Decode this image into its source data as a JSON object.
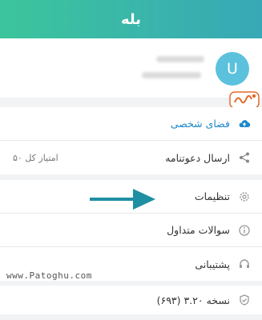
{
  "header": {
    "title": "بله"
  },
  "profile": {
    "avatar_letter": "U"
  },
  "sections": {
    "first": [
      {
        "label": "فضای شخصی",
        "icon": "cloud-icon"
      },
      {
        "label": "ارسال دعوتنامه",
        "value": "امتیاز کل ۵۰",
        "icon": "share-icon"
      }
    ],
    "second": [
      {
        "label": "تنظیمات",
        "icon": "gear-icon"
      },
      {
        "label": "سوالات متداول",
        "icon": "info-icon"
      },
      {
        "label": "پشتیبانی",
        "icon": "headset-icon"
      }
    ],
    "third": [
      {
        "label": "نسخه ۳.۲۰ (۶۹۳)",
        "icon": "check-shield-icon"
      }
    ]
  },
  "watermark": {
    "text": "www.Patoghu.com",
    "logo_text": "پاتوق"
  },
  "colors": {
    "accent": "#1e88c9",
    "header_start": "#3cc59c",
    "header_end": "#38a8b6",
    "avatar": "#5cc1dc",
    "arrow": "#1f8fa3"
  }
}
